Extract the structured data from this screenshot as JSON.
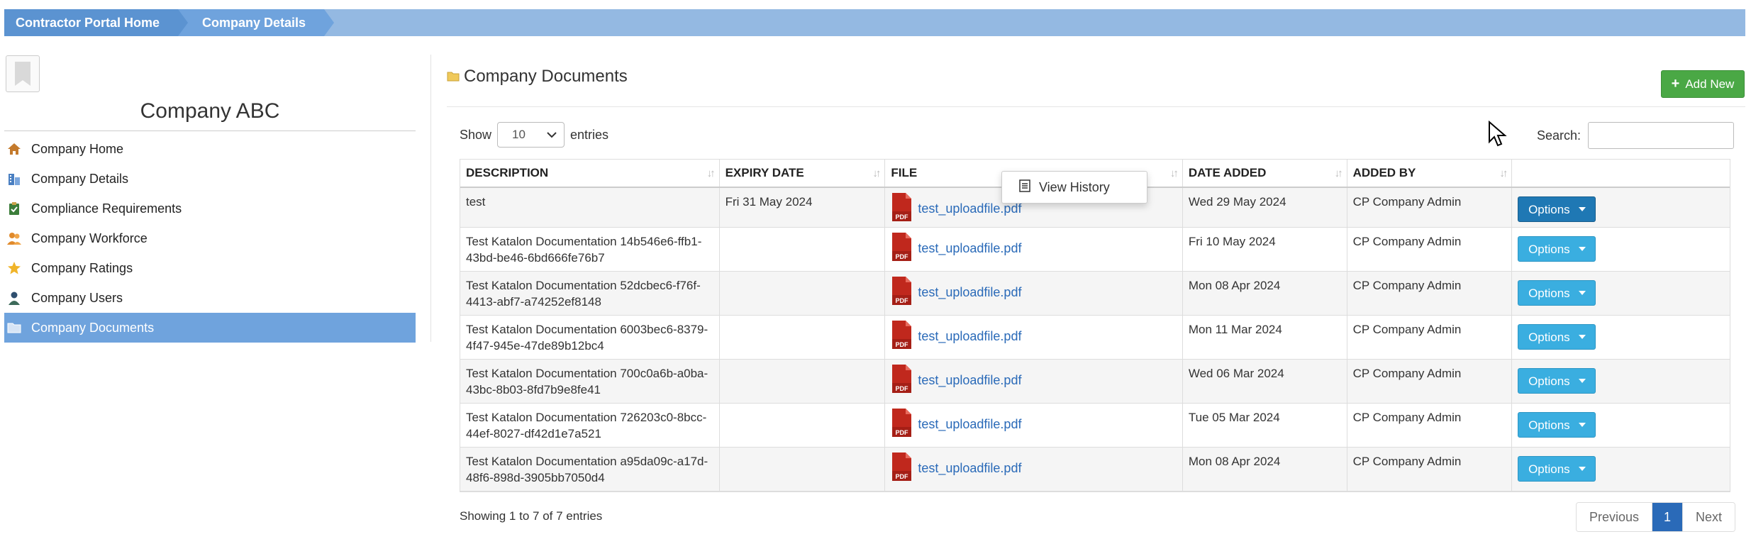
{
  "breadcrumb": [
    "Contractor Portal Home",
    "Company Details"
  ],
  "sidebar": {
    "company_name": "Company ABC",
    "items": [
      {
        "label": "Company Home",
        "icon": "home-icon",
        "active": false
      },
      {
        "label": "Company Details",
        "icon": "building-icon",
        "active": false
      },
      {
        "label": "Compliance Requirements",
        "icon": "clipboard-check-icon",
        "active": false
      },
      {
        "label": "Company Workforce",
        "icon": "people-icon",
        "active": false
      },
      {
        "label": "Company Ratings",
        "icon": "star-icon",
        "active": false
      },
      {
        "label": "Company Users",
        "icon": "user-icon",
        "active": false
      },
      {
        "label": "Company Documents",
        "icon": "folder-icon",
        "active": true
      }
    ]
  },
  "main": {
    "title": "Company Documents",
    "add_button": "Add New",
    "show_label": "Show",
    "entries_label": "entries",
    "page_length": "10",
    "search_label": "Search:",
    "search_value": "",
    "columns": [
      "DESCRIPTION",
      "EXPIRY DATE",
      "FILE",
      "DATE ADDED",
      "ADDED BY"
    ],
    "rows": [
      {
        "description": "test",
        "expiry": "Fri 31 May 2024",
        "file": "test_uploadfile.pdf",
        "date_added": "Wed 29 May 2024",
        "added_by": "CP Company Admin",
        "options": "Options"
      },
      {
        "description": "Test Katalon Documentation 14b546e6-ffb1-43bd-be46-6bd666fe76b7",
        "expiry": "",
        "file": "test_uploadfile.pdf",
        "date_added": "Fri 10 May 2024",
        "added_by": "CP Company Admin",
        "options": "Options"
      },
      {
        "description": "Test Katalon Documentation 52dcbec6-f76f-4413-abf7-a74252ef8148",
        "expiry": "",
        "file": "test_uploadfile.pdf",
        "date_added": "Mon 08 Apr 2024",
        "added_by": "CP Company Admin",
        "options": "Options"
      },
      {
        "description": "Test Katalon Documentation 6003bec6-8379-4f47-945e-47de89b12bc4",
        "expiry": "",
        "file": "test_uploadfile.pdf",
        "date_added": "Mon 11 Mar 2024",
        "added_by": "CP Company Admin",
        "options": "Options"
      },
      {
        "description": "Test Katalon Documentation 700c0a6b-a0ba-43bc-8b03-8fd7b9e8fe41",
        "expiry": "",
        "file": "test_uploadfile.pdf",
        "date_added": "Wed 06 Mar 2024",
        "added_by": "CP Company Admin",
        "options": "Options"
      },
      {
        "description": "Test Katalon Documentation 726203c0-8bcc-44ef-8027-df42d1e7a521",
        "expiry": "",
        "file": "test_uploadfile.pdf",
        "date_added": "Tue 05 Mar 2024",
        "added_by": "CP Company Admin",
        "options": "Options"
      },
      {
        "description": "Test Katalon Documentation a95da09c-a17d-48f6-898d-3905bb7050d4",
        "expiry": "",
        "file": "test_uploadfile.pdf",
        "date_added": "Mon 08 Apr 2024",
        "added_by": "CP Company Admin",
        "options": "Options"
      }
    ],
    "dropdown_item": "View History",
    "info": "Showing 1 to 7 of 7 entries",
    "pagination": {
      "previous": "Previous",
      "current": "1",
      "next": "Next"
    }
  },
  "colors": {
    "accent": "#6fa3dd",
    "breadcrumb_bg": "#94b9e2",
    "add_green": "#4aa845",
    "options_blue": "#3aaee0",
    "link": "#2a6ab8"
  }
}
